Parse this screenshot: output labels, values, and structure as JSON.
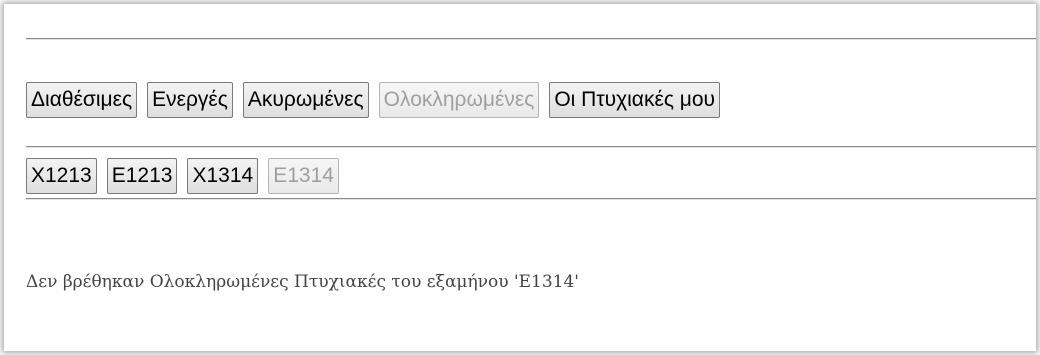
{
  "tabs": [
    {
      "label": "Διαθέσιμες",
      "disabled": false
    },
    {
      "label": "Ενεργές",
      "disabled": false
    },
    {
      "label": "Ακυρωμένες",
      "disabled": false
    },
    {
      "label": "Ολοκληρωμένες",
      "disabled": true
    },
    {
      "label": "Οι Πτυχιακές μου",
      "disabled": false
    }
  ],
  "semesters": [
    {
      "label": "X1213",
      "disabled": false
    },
    {
      "label": "E1213",
      "disabled": false
    },
    {
      "label": "X1314",
      "disabled": false
    },
    {
      "label": "E1314",
      "disabled": true
    }
  ],
  "message": "Δεν βρέθηκαν Ολοκληρωμένες Πτυχιακές του εξαμήνου 'E1314'"
}
